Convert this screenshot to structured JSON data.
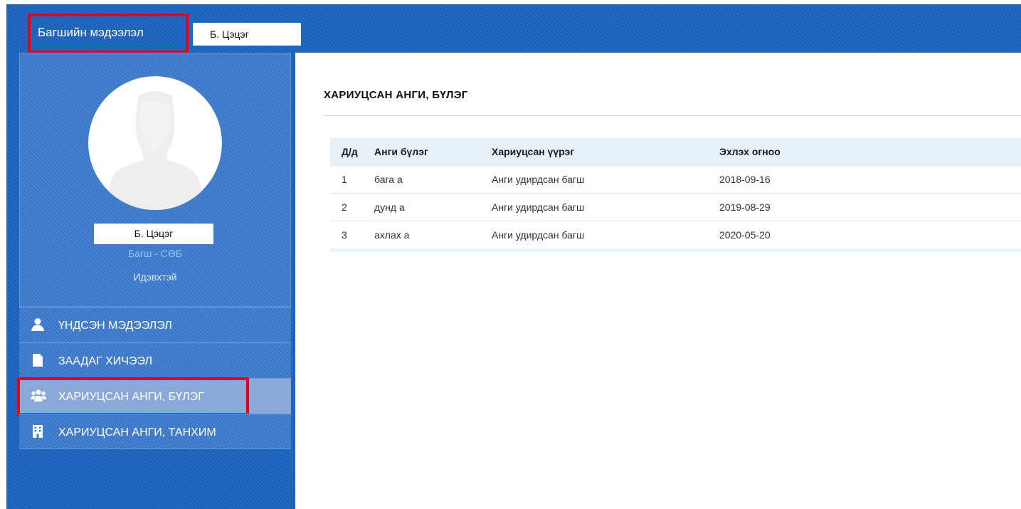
{
  "header": {
    "title": "Багшийн мэдээлэл",
    "user_name": "Б. Цэцэг"
  },
  "profile": {
    "name": "Б. Цэцэг",
    "role": "Багш - СӨБ",
    "status": "Идэвхтэй"
  },
  "menu": {
    "items": [
      {
        "label": "ҮНДСЭН МЭДЭЭЛЭЛ",
        "icon": "user-icon"
      },
      {
        "label": "ЗААДАГ ХИЧЭЭЛ",
        "icon": "document-icon"
      },
      {
        "label": "ХАРИУЦСАН АНГИ, БҮЛЭГ",
        "icon": "users-group-icon"
      },
      {
        "label": "ХАРИУЦСАН АНГИ, ТАНХИМ",
        "icon": "building-icon"
      }
    ]
  },
  "content": {
    "title": "ХАРИУЦСАН АНГИ, БҮЛЭГ",
    "table": {
      "headers": [
        "Д/д",
        "Анги бүлэг",
        "Хариуцсан үүрэг",
        "Эхлэх огноо"
      ],
      "rows": [
        [
          "1",
          "бага а",
          "Анги удирдсан багш",
          "2018-09-16"
        ],
        [
          "2",
          "дунд а",
          "Анги удирдсан багш",
          "2019-08-29"
        ],
        [
          "3",
          "ахлах а",
          "Анги удирдсан багш",
          "2020-05-20"
        ]
      ]
    }
  },
  "colors": {
    "header_bg": "#1d63bd",
    "panel_bg": "#3f7ccd",
    "active_item_bg": "#8aa9d8",
    "highlight_border": "#e3001b",
    "role_text": "#8cc9ff"
  }
}
